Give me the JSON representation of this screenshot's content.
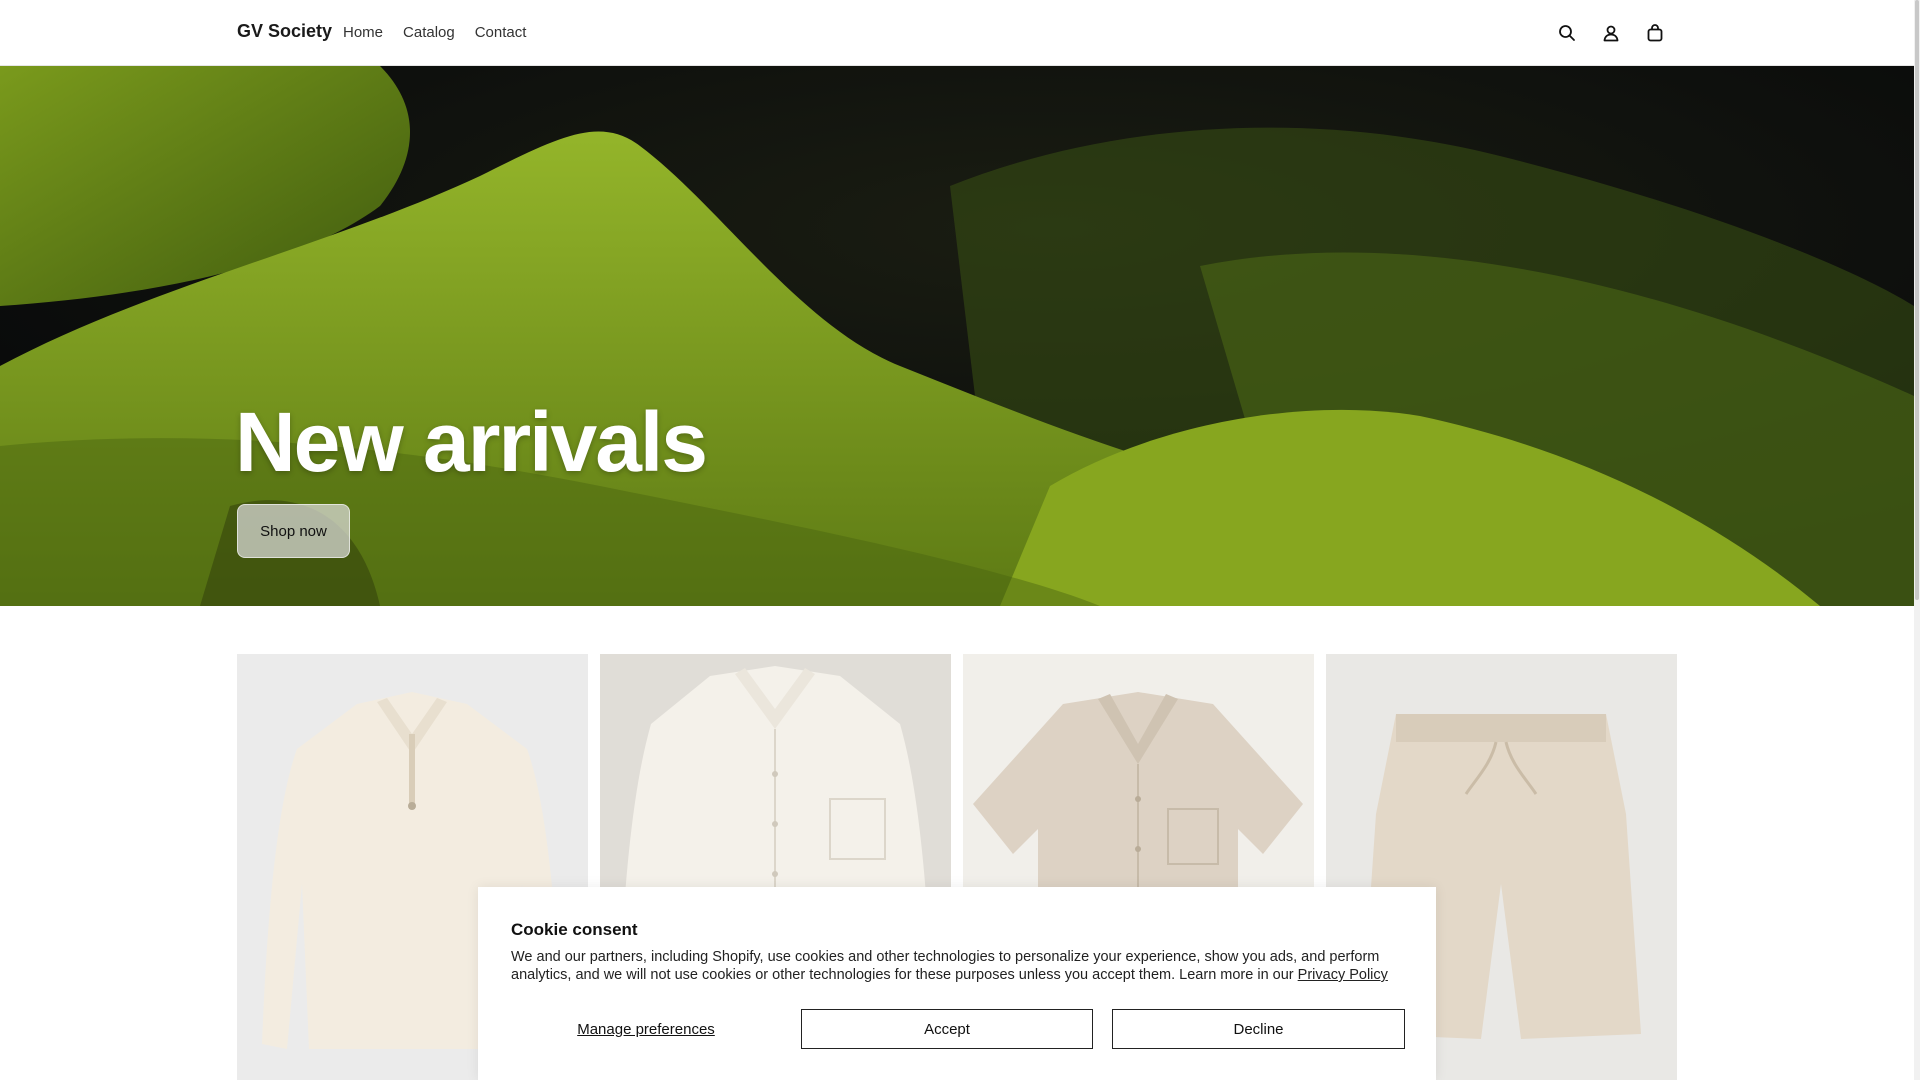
{
  "header": {
    "brand": "GV Society",
    "nav": [
      {
        "label": "Home"
      },
      {
        "label": "Catalog"
      },
      {
        "label": "Contact"
      }
    ],
    "icons": [
      "search-icon",
      "account-icon",
      "cart-icon"
    ]
  },
  "hero": {
    "title": "New arrivals",
    "button_label": "Shop now"
  },
  "products": [
    {
      "image": "cream-knit-half-zip-polo-sweater"
    },
    {
      "image": "white-linen-long-sleeve-shirt"
    },
    {
      "image": "beige-linen-short-sleeve-shirt"
    },
    {
      "image": "beige-linen-drawstring-shorts"
    }
  ],
  "cookie": {
    "title": "Cookie consent",
    "text": "We and our partners, including Shopify, use cookies and other technologies to personalize your experience, show you ads, and perform analytics, and we will not use cookies or other technologies for these purposes unless you accept them. Learn more in our ",
    "link": "Privacy Policy",
    "manage_label": "Manage preferences",
    "accept_label": "Accept",
    "decline_label": "Decline"
  },
  "colors": {
    "moss": "#7a9a1c",
    "dark": "#0d0e0a",
    "product_bg": "#ebe9e5"
  }
}
